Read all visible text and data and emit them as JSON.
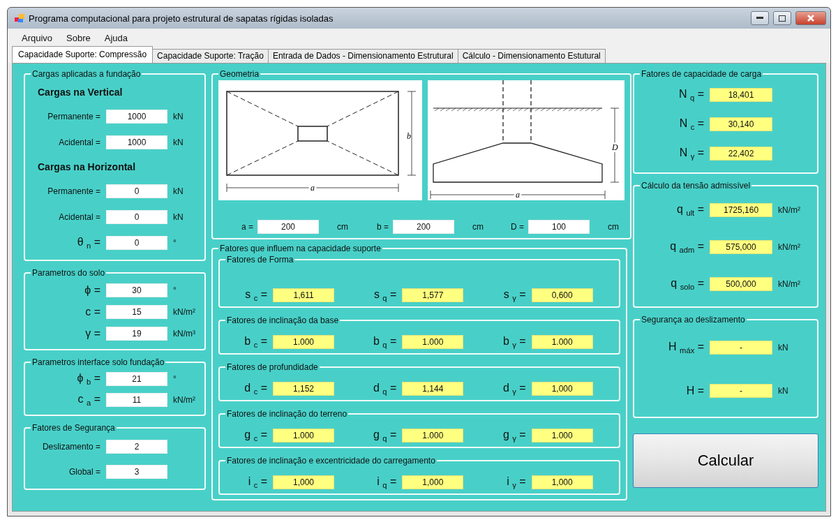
{
  "window": {
    "title": "Programa computacional para projeto estrutural de sapatas rígidas isoladas"
  },
  "menu": [
    "Arquivo",
    "Sobre",
    "Ajuda"
  ],
  "tabs": [
    {
      "label": "Capacidade Suporte: Compressão",
      "selected": true
    },
    {
      "label": "Capacidade Suporte: Tração",
      "selected": false
    },
    {
      "label": "Entrada de Dados - Dimensionamento Estrutural",
      "selected": false
    },
    {
      "label": "Cálculo - Dimensionamento Estutural",
      "selected": false
    }
  ],
  "left_groups": [
    {
      "title": "Cargas aplicadas a fundação",
      "rows": [
        {
          "kind": "heading",
          "label": "Cargas na Vertical"
        },
        {
          "kind": "text",
          "label": "Permanente =",
          "value": "1000",
          "unit": "kN"
        },
        {
          "kind": "text",
          "label": "Acidental =",
          "value": "1000",
          "unit": "kN"
        },
        {
          "kind": "heading",
          "label": "Cargas na Horizontal"
        },
        {
          "kind": "text",
          "label": "Permanente =",
          "value": "0",
          "unit": "kN"
        },
        {
          "kind": "text",
          "label": "Acidental =",
          "value": "0",
          "unit": "kN"
        },
        {
          "kind": "symbol",
          "label": "θ $_{n}$ =",
          "value": "0",
          "unit": "°"
        }
      ]
    },
    {
      "title": "Parametros do solo",
      "rows": [
        {
          "kind": "symbol",
          "label": "ϕ =",
          "value": "30",
          "unit": "°"
        },
        {
          "kind": "symbol",
          "label": "c =",
          "value": "15",
          "unit": "kN/m²"
        },
        {
          "kind": "symbol",
          "label": "γ =",
          "value": "19",
          "unit": "kN/m³"
        }
      ]
    },
    {
      "title": "Parametros interface solo fundação",
      "rows": [
        {
          "kind": "symbol",
          "label": "ϕ $_{b}$ =",
          "value": "21",
          "unit": "°"
        },
        {
          "kind": "symbol",
          "label": "c $_{a}$ =",
          "value": "11",
          "unit": "kN/m²"
        }
      ]
    },
    {
      "title": "Fatores de Segurança",
      "rows": [
        {
          "kind": "text",
          "label": "Deslizamento =",
          "value": "2"
        },
        {
          "kind": "text",
          "label": "Global =",
          "value": "3"
        }
      ]
    }
  ],
  "geometry": {
    "title": "Geometria",
    "plan_labels": [
      "b",
      "a"
    ],
    "section_labels": [
      "D",
      "a"
    ],
    "fields": [
      {
        "label": "a =",
        "value": "200",
        "unit": "cm"
      },
      {
        "label": "b =",
        "value": "200",
        "unit": "cm"
      },
      {
        "label": "D =",
        "value": "100",
        "unit": "cm"
      }
    ]
  },
  "factors": {
    "title": "Fatores que influem na capacidade suporte",
    "groups": [
      {
        "title": "Fatores de Forma",
        "fields": [
          {
            "label": "s $_{c}$ =",
            "value": "1,611"
          },
          {
            "label": "s $_{q}$ =",
            "value": "1,577"
          },
          {
            "label": "s $_{γ}$ =",
            "value": "0,600"
          }
        ]
      },
      {
        "title": "Fatores de inclinação da base",
        "fields": [
          {
            "label": "b $_{c}$ =",
            "value": "1.000"
          },
          {
            "label": "b $_{q}$ =",
            "value": "1.000"
          },
          {
            "label": "b $_{γ}$ =",
            "value": "1.000"
          }
        ]
      },
      {
        "title": "Fatores de profundidade",
        "fields": [
          {
            "label": "d $_{c}$ =",
            "value": "1,152"
          },
          {
            "label": "d $_{q}$ =",
            "value": "1,144"
          },
          {
            "label": "d $_{γ}$ =",
            "value": "1,000"
          }
        ]
      },
      {
        "title": "Fatores de inclinação do terreno",
        "fields": [
          {
            "label": "g $_{c}$ =",
            "value": "1.000"
          },
          {
            "label": "g $_{q}$ =",
            "value": "1.000"
          },
          {
            "label": "g $_{γ}$ =",
            "value": "1.000"
          }
        ]
      },
      {
        "title": "Fatores de inclinação e excentricidade do carregamento",
        "fields": [
          {
            "label": "i $_{c}$ =",
            "value": "1,000"
          },
          {
            "label": "i $_{q}$ =",
            "value": "1,000"
          },
          {
            "label": "i $_{γ}$ =",
            "value": "1,000"
          }
        ]
      }
    ]
  },
  "right_groups": [
    {
      "title": "Fatores de capacidade de carga",
      "fields": [
        {
          "label": "N $_{q}$ =",
          "value": "18,401"
        },
        {
          "label": "N $_{c}$ =",
          "value": "30,140"
        },
        {
          "label": "N $_{γ}$ =",
          "value": "22,402"
        }
      ]
    },
    {
      "title": "Cálculo da tensão admissível",
      "fields": [
        {
          "label": "q $_{ult}$ =",
          "value": "1725,160",
          "unit": "kN/m²"
        },
        {
          "label": "q $_{adm}$ =",
          "value": "575,000",
          "unit": "kN/m²"
        },
        {
          "label": "q $_{solo}$ =",
          "value": "500,000",
          "unit": "kN/m²"
        }
      ]
    },
    {
      "title": "Segurança ao deslizamento",
      "fields": [
        {
          "label": "H $_{máx}$ =",
          "value": "-",
          "unit": "kN"
        },
        {
          "label": "H =",
          "value": "-",
          "unit": "kN"
        }
      ]
    }
  ],
  "calculate_button": "Calcular"
}
